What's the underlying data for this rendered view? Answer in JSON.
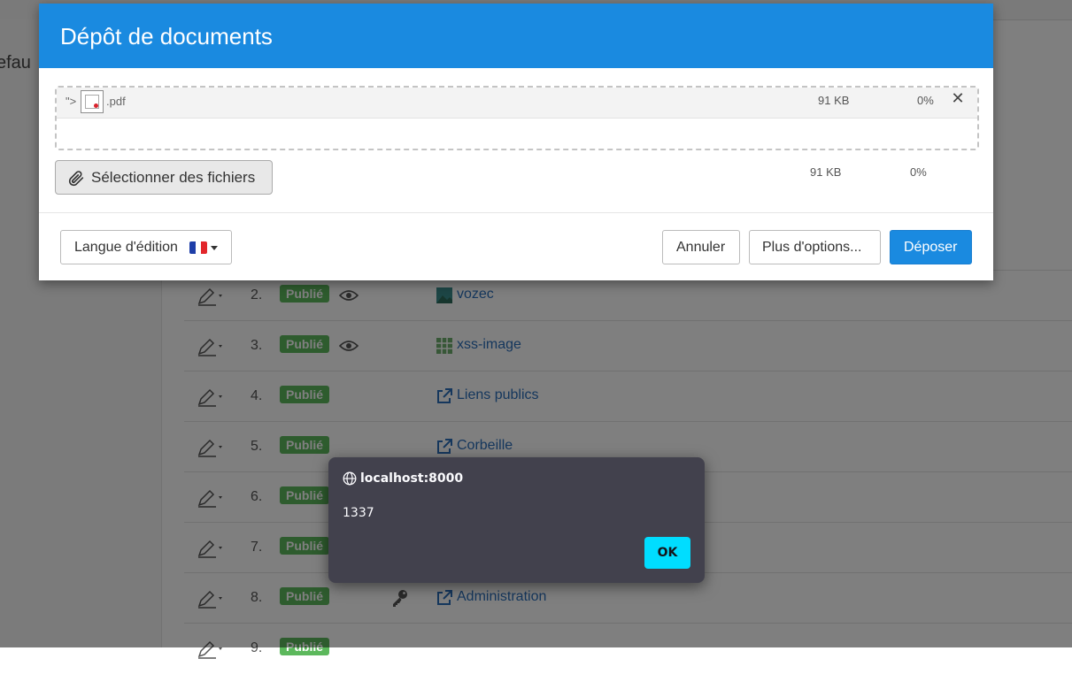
{
  "background": {
    "cut_label": "efau",
    "rows": [
      {
        "num": "2.",
        "status": "Publié",
        "eye": true,
        "key": false,
        "icon": "image-icon",
        "title": "vozec"
      },
      {
        "num": "3.",
        "status": "Publié",
        "eye": true,
        "key": false,
        "icon": "image-grid-icon",
        "title": "xss-image"
      },
      {
        "num": "4.",
        "status": "Publié",
        "eye": false,
        "key": false,
        "icon": "external-link-icon",
        "title": "Liens publics"
      },
      {
        "num": "5.",
        "status": "Publié",
        "eye": false,
        "key": false,
        "icon": "external-link-icon",
        "title": "Corbeille"
      },
      {
        "num": "6.",
        "status": "Publié",
        "eye": false,
        "key": false,
        "icon": "",
        "title": ""
      },
      {
        "num": "7.",
        "status": "Publié",
        "eye": false,
        "key": false,
        "icon": "",
        "title": ""
      },
      {
        "num": "8.",
        "status": "Publié",
        "eye": false,
        "key": true,
        "icon": "external-link-icon",
        "title": "Administration"
      },
      {
        "num": "9.",
        "status": "Publié",
        "eye": false,
        "key": false,
        "icon": "",
        "title": ""
      }
    ]
  },
  "modal": {
    "title": "Dépôt de documents",
    "file": {
      "name_prefix": "\">",
      "name_ext": ".pdf",
      "size": "91 KB",
      "progress": "0%"
    },
    "select_button": "Sélectionner des fichiers",
    "total_size": "91 KB",
    "total_progress": "0%",
    "footer": {
      "language_button": "Langue d'édition",
      "cancel_button": "Annuler",
      "more_button": "Plus d'options...",
      "submit_button": "Déposer"
    }
  },
  "alert": {
    "origin": "localhost:8000",
    "message": "1337",
    "ok_button": "OK"
  },
  "colors": {
    "primary": "#1a8ae0",
    "published_badge": "#5cb85c",
    "alert_bg": "#42414d",
    "alert_ok": "#00ddff"
  }
}
